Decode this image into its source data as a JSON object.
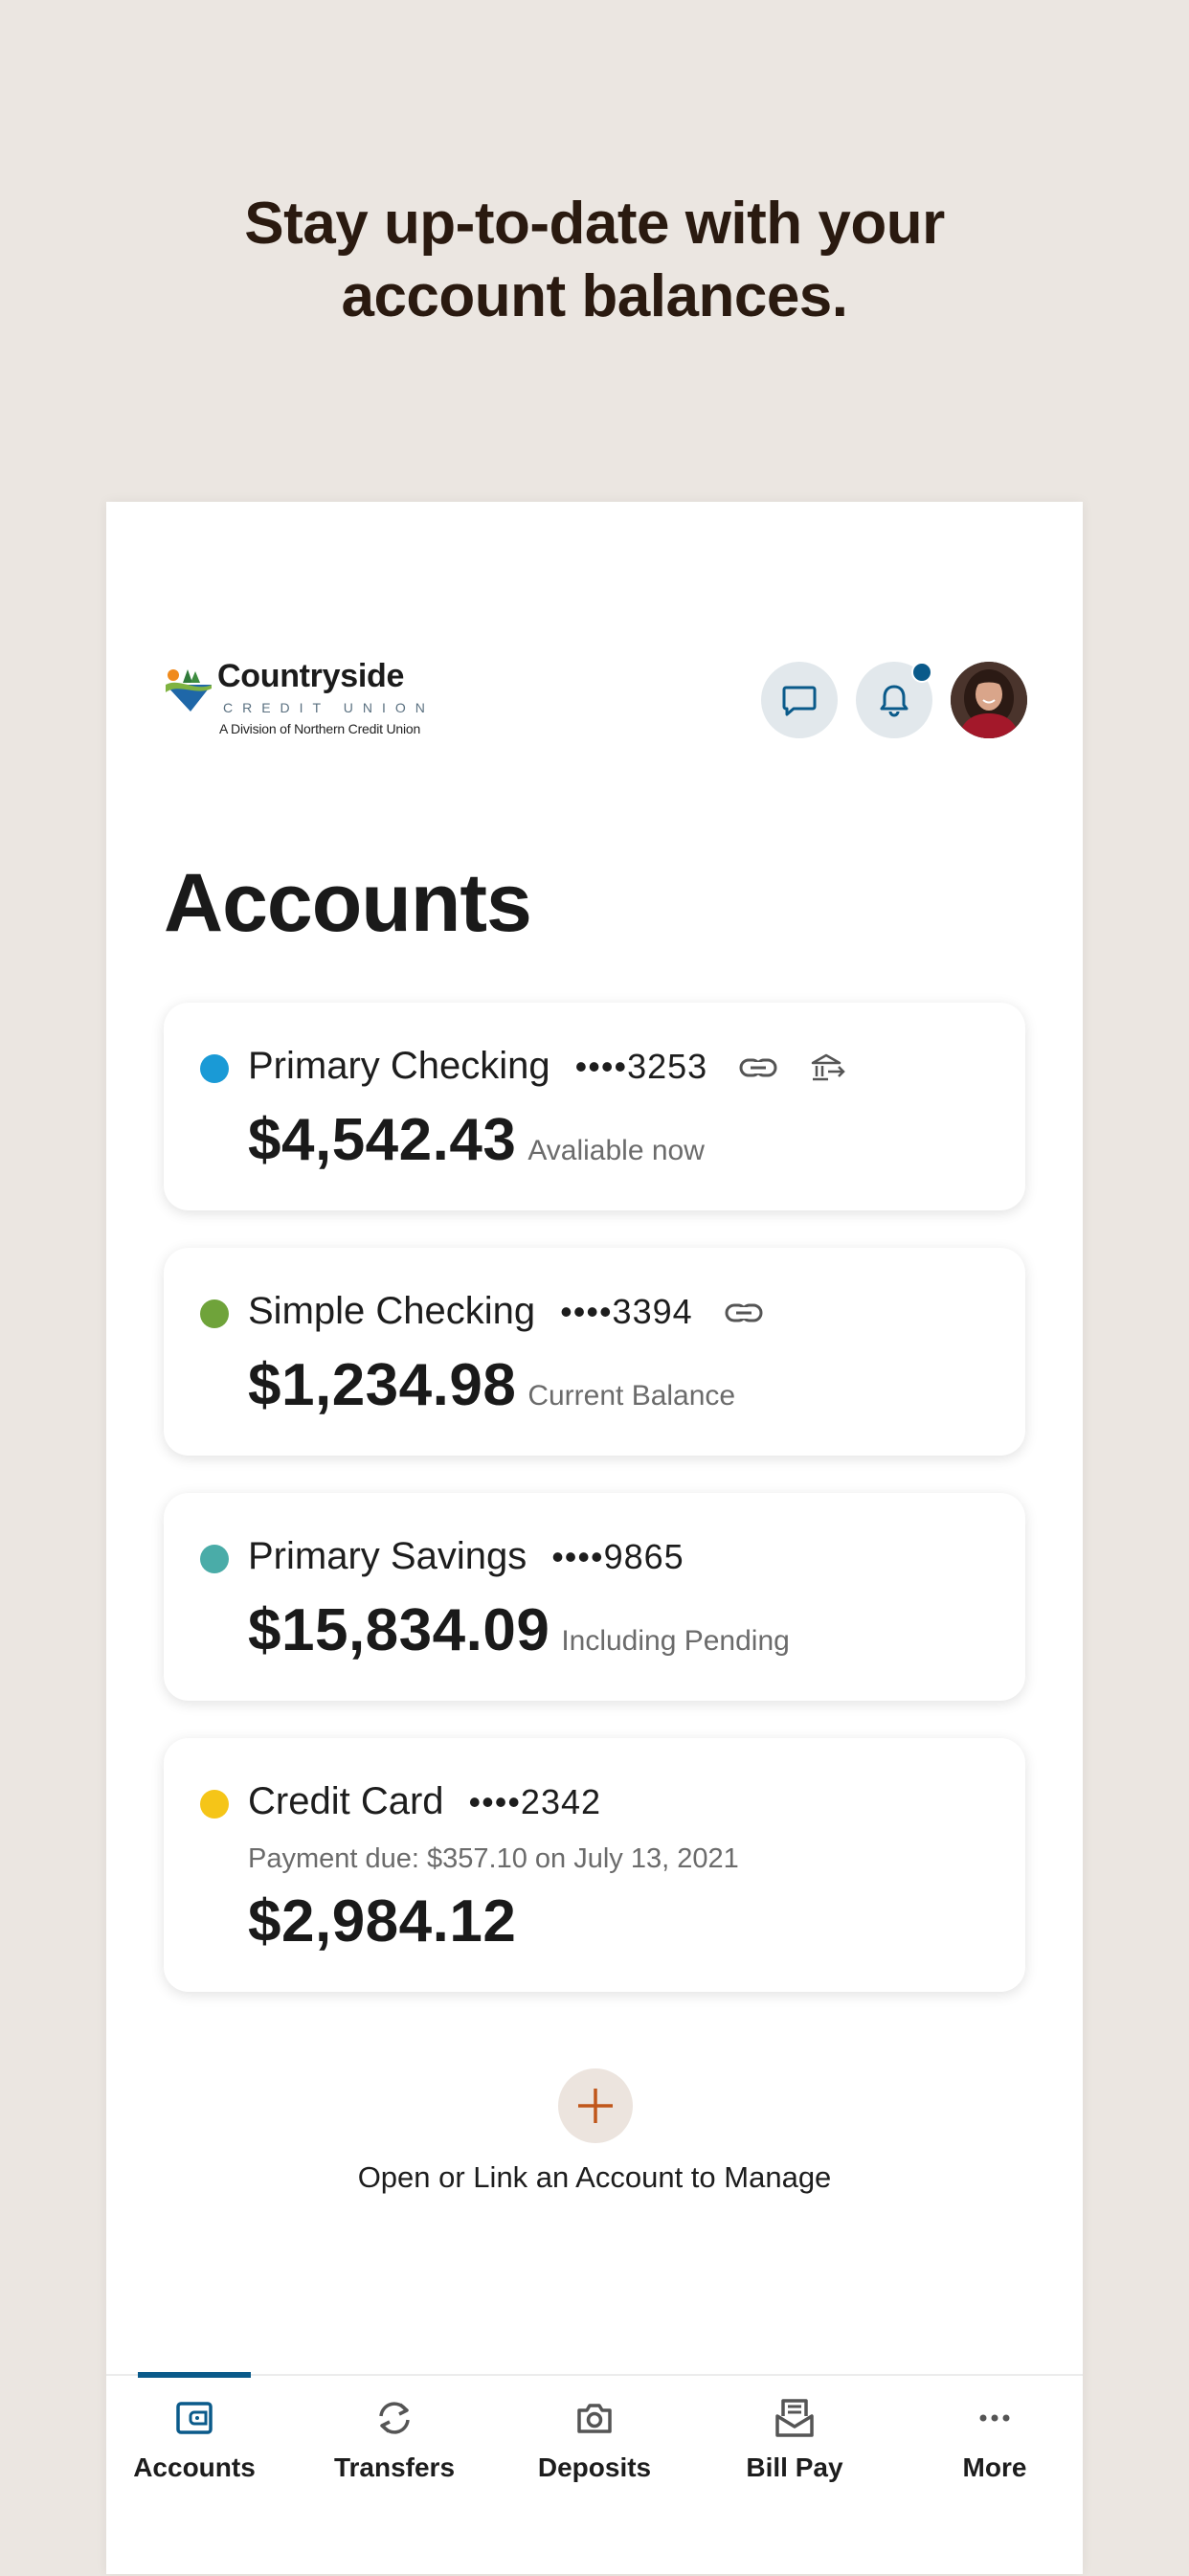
{
  "headline": {
    "line1": "Stay up-to-date with your",
    "line2": "account balances."
  },
  "brand": {
    "name": "Countryside",
    "sub": "CREDIT UNION",
    "division": "A Division of Northern Credit Union"
  },
  "header": {
    "chat_icon": "chat-bubble-icon",
    "bell_icon": "bell-icon",
    "has_notification": true
  },
  "page_title": "Accounts",
  "accounts": [
    {
      "name": "Primary Checking",
      "mask": "••••3253",
      "amount": "$4,542.43",
      "caption": "Avaliable now",
      "color": "#1a9ad6",
      "icons": [
        "link-icon",
        "bank-transfer-icon"
      ]
    },
    {
      "name": "Simple Checking",
      "mask": "••••3394",
      "amount": "$1,234.98",
      "caption": "Current Balance",
      "color": "#6fa33a",
      "icons": [
        "link-icon"
      ]
    },
    {
      "name": "Primary Savings",
      "mask": "••••9865",
      "amount": "$15,834.09",
      "caption": "Including Pending",
      "color": "#4aaca8",
      "icons": []
    },
    {
      "name": "Credit Card",
      "mask": "••••2342",
      "subline": "Payment due: $357.10 on July 13, 2021",
      "amount": "$2,984.12",
      "caption": "",
      "color": "#f5c518",
      "icons": []
    }
  ],
  "add_account": {
    "label": "Open or Link an Account to Manage",
    "icon": "plus-icon"
  },
  "tabs": [
    {
      "label": "Accounts",
      "icon": "wallet-icon",
      "active": true
    },
    {
      "label": "Transfers",
      "icon": "transfer-arrows-icon",
      "active": false
    },
    {
      "label": "Deposits",
      "icon": "camera-icon",
      "active": false
    },
    {
      "label": "Bill Pay",
      "icon": "bill-icon",
      "active": false
    },
    {
      "label": "More",
      "icon": "more-dots-icon",
      "active": false
    }
  ],
  "colors": {
    "accent": "#0a5a8a",
    "background": "#ebe6e1",
    "add_plus": "#c0561a"
  }
}
